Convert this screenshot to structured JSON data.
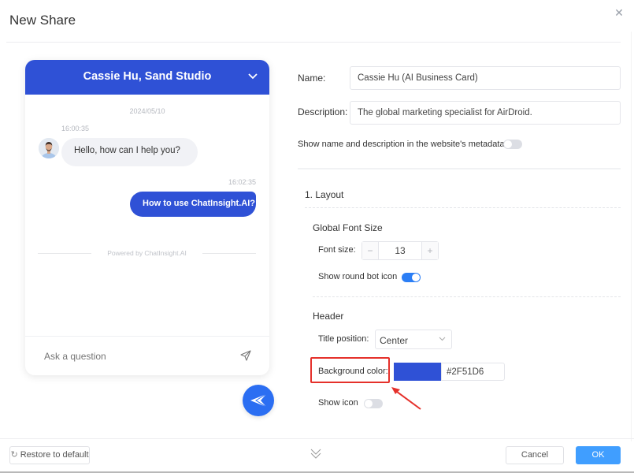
{
  "dialog": {
    "title": "New Share",
    "close_icon": "close-icon"
  },
  "preview": {
    "header_title": "Cassie Hu, Sand Studio",
    "header_bg_color": "#2F51D6",
    "date": "2024/05/10",
    "messages": [
      {
        "sender": "bot",
        "time": "16:00:35",
        "text": "Hello, how can I help you?"
      },
      {
        "sender": "user",
        "time": "16:02:35",
        "text": "How to use ChatInsight.AI?"
      }
    ],
    "powered_by": "Powered by ChatInsight.AI",
    "input_placeholder": "Ask a question",
    "send_icon": "paper-plane-icon",
    "launcher_icon": "bot-launcher-icon"
  },
  "form": {
    "name_label": "Name:",
    "name_value": "Cassie Hu (AI Business Card)",
    "description_label": "Description:",
    "description_value": "The global marketing specialist for AirDroid.",
    "metadata_toggle_label": "Show name and description in the website's metadata",
    "metadata_toggle_on": false,
    "layout_section": "1. Layout",
    "global_font_size_heading": "Global Font Size",
    "font_size_label": "Font size:",
    "font_size_value": "13",
    "font_size_minus": "−",
    "font_size_plus": "+",
    "round_bot_icon_label": "Show round bot icon",
    "round_bot_icon_on": true,
    "header_heading": "Header",
    "title_position_label": "Title position:",
    "title_position_value": "Center",
    "background_color_label": "Background color:",
    "background_color_value": "#2F51D6",
    "show_icon_label": "Show icon",
    "show_icon_on": false
  },
  "footer": {
    "restore_label": "Restore to default",
    "cancel_label": "Cancel",
    "ok_label": "OK"
  },
  "colors": {
    "accent": "#2F51D6",
    "primary_button": "#409EFF",
    "toggle_on": "#2B7EF5",
    "annotation": "#E5312B"
  }
}
